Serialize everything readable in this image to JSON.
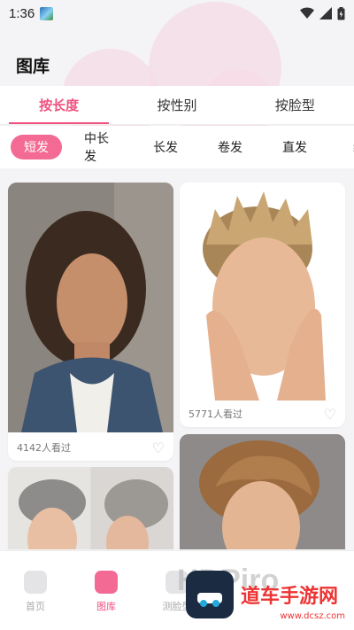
{
  "status_bar": {
    "time": "1:36"
  },
  "page": {
    "title": "图库"
  },
  "tabs": [
    {
      "label": "按长度",
      "active": true
    },
    {
      "label": "按性别",
      "active": false
    },
    {
      "label": "按脸型",
      "active": false
    }
  ],
  "chips": [
    {
      "label": "短发",
      "active": true
    },
    {
      "label": "中长发",
      "active": false
    },
    {
      "label": "长发",
      "active": false
    },
    {
      "label": "卷发",
      "active": false
    },
    {
      "label": "直发",
      "active": false
    },
    {
      "label": "编",
      "active": false
    }
  ],
  "cards": [
    {
      "views": "4142人看过"
    },
    {
      "views": "5771人看过"
    }
  ],
  "bottom_nav": [
    {
      "label": "首页",
      "icon": "home-icon",
      "active": false
    },
    {
      "label": "图库",
      "icon": "gallery-icon",
      "active": true
    },
    {
      "label": "测脸型",
      "icon": "face-scan-icon",
      "active": false
    }
  ],
  "watermark": {
    "text": "道车手游网",
    "url": "www.dcsz.com",
    "bg_text": "HDPiro"
  },
  "colors": {
    "accent": "#f0517f",
    "chip_active": "#f36b95"
  }
}
